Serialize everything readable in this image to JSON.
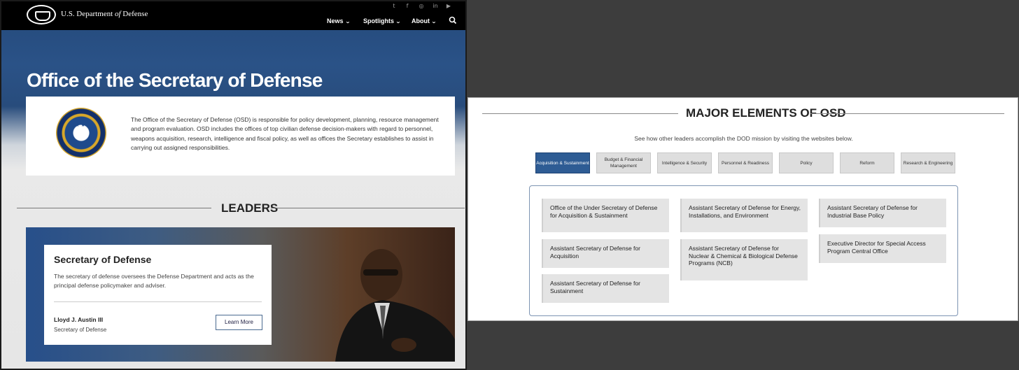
{
  "header": {
    "site_name_prefix": "U.S. Department ",
    "site_name_of": "of",
    "site_name_suffix": " Defense",
    "social_icons": [
      "twitter-icon",
      "facebook-icon",
      "instagram-icon",
      "linkedin-icon",
      "youtube-icon"
    ],
    "nav": [
      {
        "label": "News"
      },
      {
        "label": "Spotlights"
      },
      {
        "label": "About"
      }
    ]
  },
  "hero": {
    "title": "Office of the Secretary of Defense",
    "description": "The Office of the Secretary of Defense (OSD) is responsible for policy development, planning, resource management and program evaluation. OSD includes the offices of top civilian defense decision-makers with regard to personnel, weapons acquisition, research, intelligence and fiscal policy, as well as offices the Secretary establishes to assist in carrying out assigned responsibilities."
  },
  "leaders": {
    "heading": "LEADERS",
    "card": {
      "title": "Secretary of Defense",
      "description": "The secretary of defense oversees the Defense Department and acts as the principal defense policymaker and adviser.",
      "name": "Lloyd J. Austin III",
      "role": "Secretary of Defense",
      "button": "Learn More"
    }
  },
  "major": {
    "heading": "MAJOR ELEMENTS OF OSD",
    "subtitle": "See how other leaders accomplish the DOD mission by visiting the websites below.",
    "tabs": [
      {
        "label": "Acquisition & Sustainment",
        "active": true
      },
      {
        "label": "Budget & Financial Management",
        "active": false
      },
      {
        "label": "Intelligence & Security",
        "active": false
      },
      {
        "label": "Personnel & Readiness",
        "active": false
      },
      {
        "label": "Policy",
        "active": false
      },
      {
        "label": "Reform",
        "active": false
      },
      {
        "label": "Research & Engineering",
        "active": false
      }
    ],
    "elements": [
      "Office of the Under Secretary of Defense for Acquisition & Sustainment",
      "Assistant Secretary of Defense for Acquisition",
      "Assistant Secretary of Defense for Sustainment",
      "Assistant Secretary of Defense for Energy, Installations, and Environment",
      "Assistant Secretary of Defense for Nuclear & Chemical & Biological Defense Programs (NCB)",
      "Assistant Secretary of Defense for Industrial Base Policy",
      "Executive Director for Special Access Program Central Office"
    ]
  },
  "colors": {
    "accent": "#2e5c94",
    "nav_bg": "#000000"
  }
}
